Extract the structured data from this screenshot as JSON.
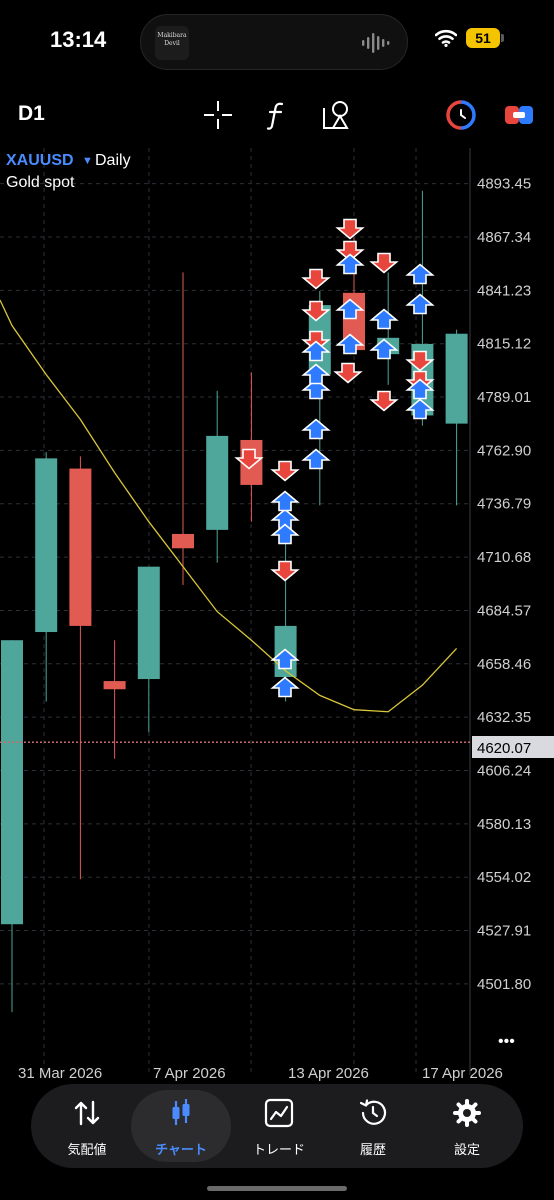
{
  "status_bar": {
    "time": "13:14",
    "battery": "51",
    "now_playing_text": "Makibara Devil"
  },
  "toolbar": {
    "timeframe": "D1",
    "icons": [
      "crosshair-icon",
      "indicator-f-icon",
      "objects-icon",
      "one-click-trading-icon",
      "trade-toggle-icon"
    ]
  },
  "chart_info": {
    "symbol": "XAUUSD",
    "timeframe_label": "Daily",
    "description": "Gold spot"
  },
  "price_axis": [
    "4893.45",
    "4867.34",
    "4841.23",
    "4815.12",
    "4789.01",
    "4762.90",
    "4736.79",
    "4710.68",
    "4684.57",
    "4658.46",
    "4632.35",
    "4606.24",
    "4580.13",
    "4554.02",
    "4527.91",
    "4501.80"
  ],
  "current_price": "4620.07",
  "date_axis": [
    "31 Mar 2026",
    "7 Apr 2026",
    "13 Apr 2026",
    "17 Apr 2026"
  ],
  "more_label": "•••",
  "colors": {
    "bull": "#4fa69a",
    "bear": "#e15b52",
    "ma": "#d8c63a",
    "price_line": "#c86a6a",
    "accent": "#4a8cff",
    "arrow_buy": "#2f7bff",
    "arrow_sell": "#e8453c"
  },
  "chart_data": {
    "type": "candlestick",
    "title": "XAUUSD Daily",
    "ylim": [
      4490,
      4906
    ],
    "x_ticks": [
      "31 Mar 2026",
      "7 Apr 2026",
      "13 Apr 2026",
      "17 Apr 2026"
    ],
    "candles": [
      {
        "o": 4531,
        "h": 4625,
        "l": 4488,
        "c": 4670
      },
      {
        "o": 4674,
        "h": 4762,
        "l": 4640,
        "c": 4759
      },
      {
        "o": 4754,
        "h": 4760,
        "l": 4553,
        "c": 4677
      },
      {
        "o": 4650,
        "h": 4670,
        "l": 4612,
        "c": 4646
      },
      {
        "o": 4651,
        "h": 4655,
        "l": 4625,
        "c": 4706
      },
      {
        "o": 4722,
        "h": 4850,
        "l": 4697,
        "c": 4715
      },
      {
        "o": 4724,
        "h": 4792,
        "l": 4708,
        "c": 4770
      },
      {
        "o": 4768,
        "h": 4801,
        "l": 4728,
        "c": 4746
      },
      {
        "o": 4652,
        "h": 4720,
        "l": 4640,
        "c": 4677
      },
      {
        "o": 4800,
        "h": 4841,
        "l": 4736,
        "c": 4834
      },
      {
        "o": 4840,
        "h": 4867,
        "l": 4810,
        "c": 4812
      },
      {
        "o": 4810,
        "h": 4850,
        "l": 4795,
        "c": 4818
      },
      {
        "o": 4780,
        "h": 4890,
        "l": 4775,
        "c": 4815
      },
      {
        "o": 4776,
        "h": 4822,
        "l": 4736,
        "c": 4820
      }
    ],
    "moving_average": [
      4824,
      4800,
      4778,
      4752,
      4728,
      4706,
      4684,
      4670,
      4655,
      4643,
      4636,
      4635,
      4648,
      4666
    ],
    "current_price": 4620.07
  }
}
